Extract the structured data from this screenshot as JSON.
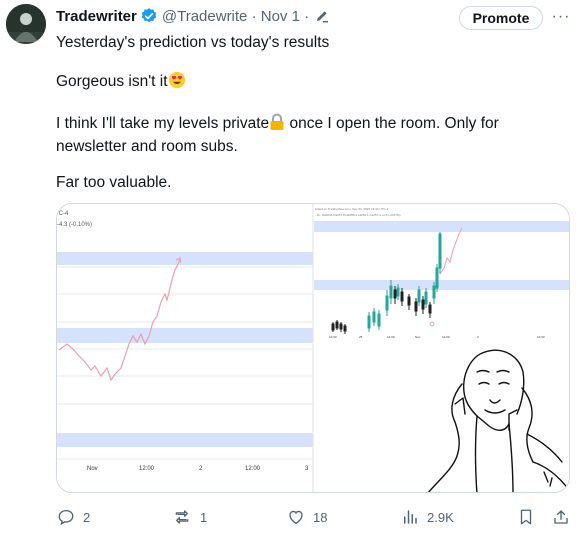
{
  "tweet": {
    "author_name": "Tradewriter",
    "handle_line": "@Tradewrite · Nov 1 ·",
    "promote_label": "Promote",
    "more_label": "···",
    "line1": "Yesterday's prediction vs today's results",
    "line2": "Gorgeous isn't it",
    "line3a": "I think I'll take my levels private",
    "line3b": " once I open the room. Only for newsletter and room subs.",
    "line4": "Far too valuable."
  },
  "media": {
    "left_chart": {
      "symbol": "/C-4",
      "change": "-4.3 (-0.10%)",
      "x_ticks": [
        "Nov",
        "12:00",
        "2",
        "12:00",
        "3"
      ]
    },
    "right_chart": {
      "header": "lished on TradingView.com, Nov 01, 2023 19:44 UTC-4",
      "subheader": "- 1h, OANDA  O4257.8 H4258.4 L4252.1 C4257.4 +2.8 (+0.07%)",
      "x_ticks": [
        "12:00",
        "25",
        "12:00",
        "Nov",
        "12:00",
        "2",
        "12:00"
      ]
    }
  },
  "actions": {
    "replies": "2",
    "reposts": "1",
    "likes": "18",
    "views": "2.9K"
  },
  "colors": {
    "band": "#d6e2fb",
    "up_candle": "#26a69a",
    "down_candle": "#222222",
    "prediction_line": "#e8a0b0"
  }
}
